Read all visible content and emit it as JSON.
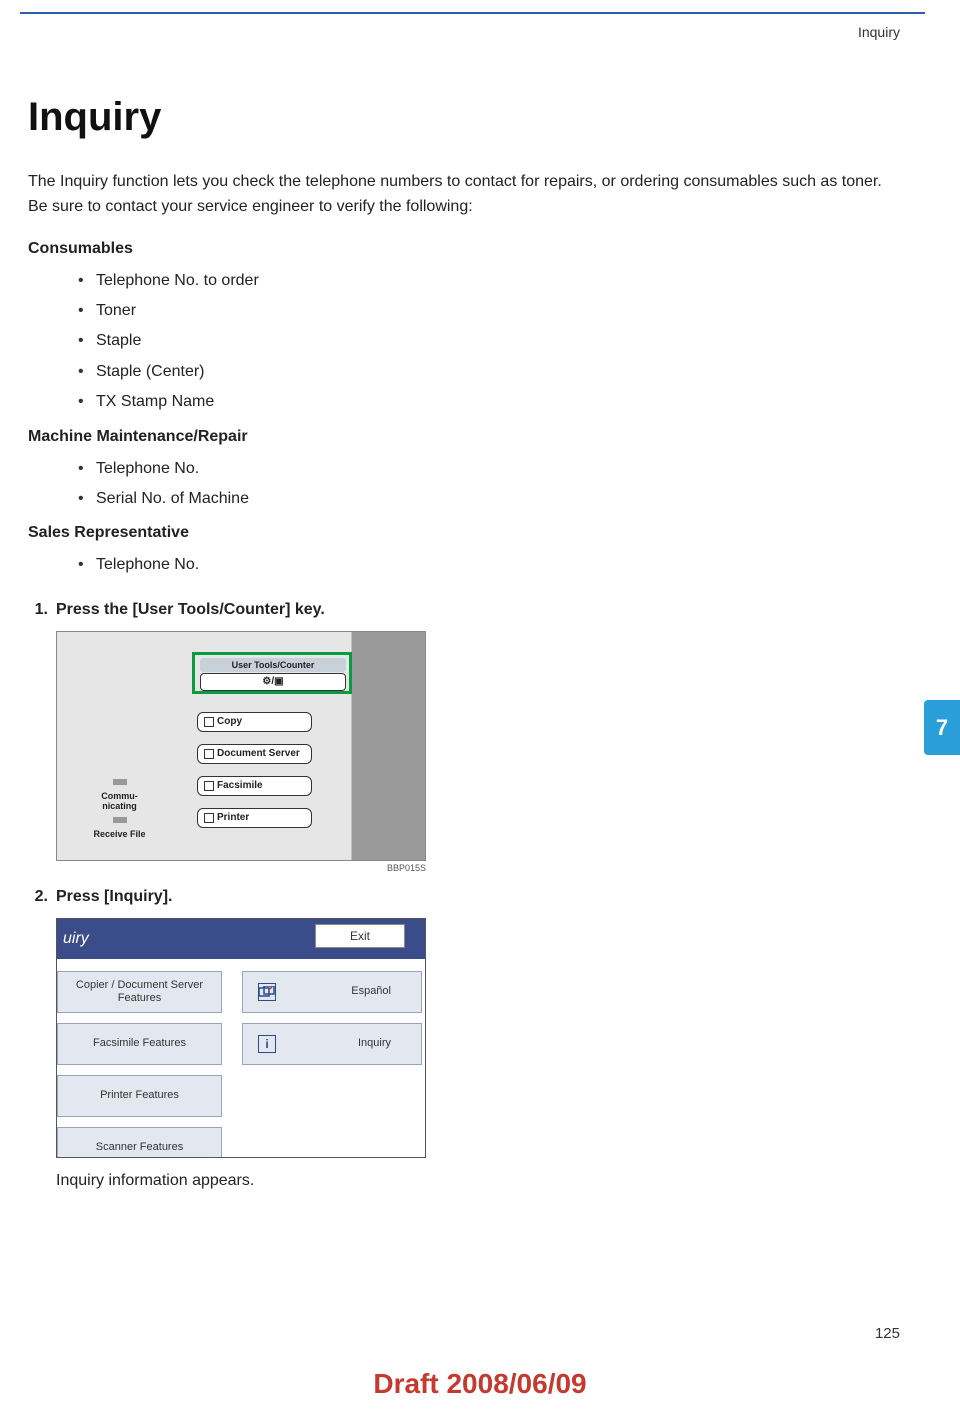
{
  "header": {
    "section": "Inquiry"
  },
  "title": "Inquiry",
  "intro": "The Inquiry function lets you check the telephone numbers to contact for repairs, or ordering consumables such as toner. Be sure to contact your service engineer to verify the following:",
  "groups": [
    {
      "heading": "Consumables",
      "items": [
        "Telephone No. to order",
        "Toner",
        "Staple",
        "Staple (Center)",
        "TX Stamp Name"
      ]
    },
    {
      "heading": "Machine Maintenance/Repair",
      "items": [
        "Telephone No.",
        "Serial No. of Machine"
      ]
    },
    {
      "heading": "Sales Representative",
      "items": [
        "Telephone No."
      ]
    }
  ],
  "steps": [
    {
      "num": "1.",
      "text": "Press the [User Tools/Counter] key."
    },
    {
      "num": "2.",
      "text": "Press [Inquiry]."
    }
  ],
  "figure1": {
    "highlighted_button": "User Tools/Counter",
    "buttons": [
      "Copy",
      "Document Server",
      "Facsimile",
      "Printer"
    ],
    "status": {
      "line1": "Commu-",
      "line2": "nicating",
      "line3": "Receive File"
    },
    "caption": "BBP015S"
  },
  "figure2": {
    "header": "uiry",
    "exit": "Exit",
    "left_buttons": [
      "Copier / Document Server Features",
      "Facsimile Features",
      "Printer Features",
      "Scanner Features"
    ],
    "right_buttons": [
      {
        "icon": "language-icon",
        "label": "Español"
      },
      {
        "icon": "info-icon",
        "label": "Inquiry"
      }
    ]
  },
  "result_text": "Inquiry information appears.",
  "page_tab": "7",
  "page_num": "125",
  "draft": "Draft 2008/06/09"
}
